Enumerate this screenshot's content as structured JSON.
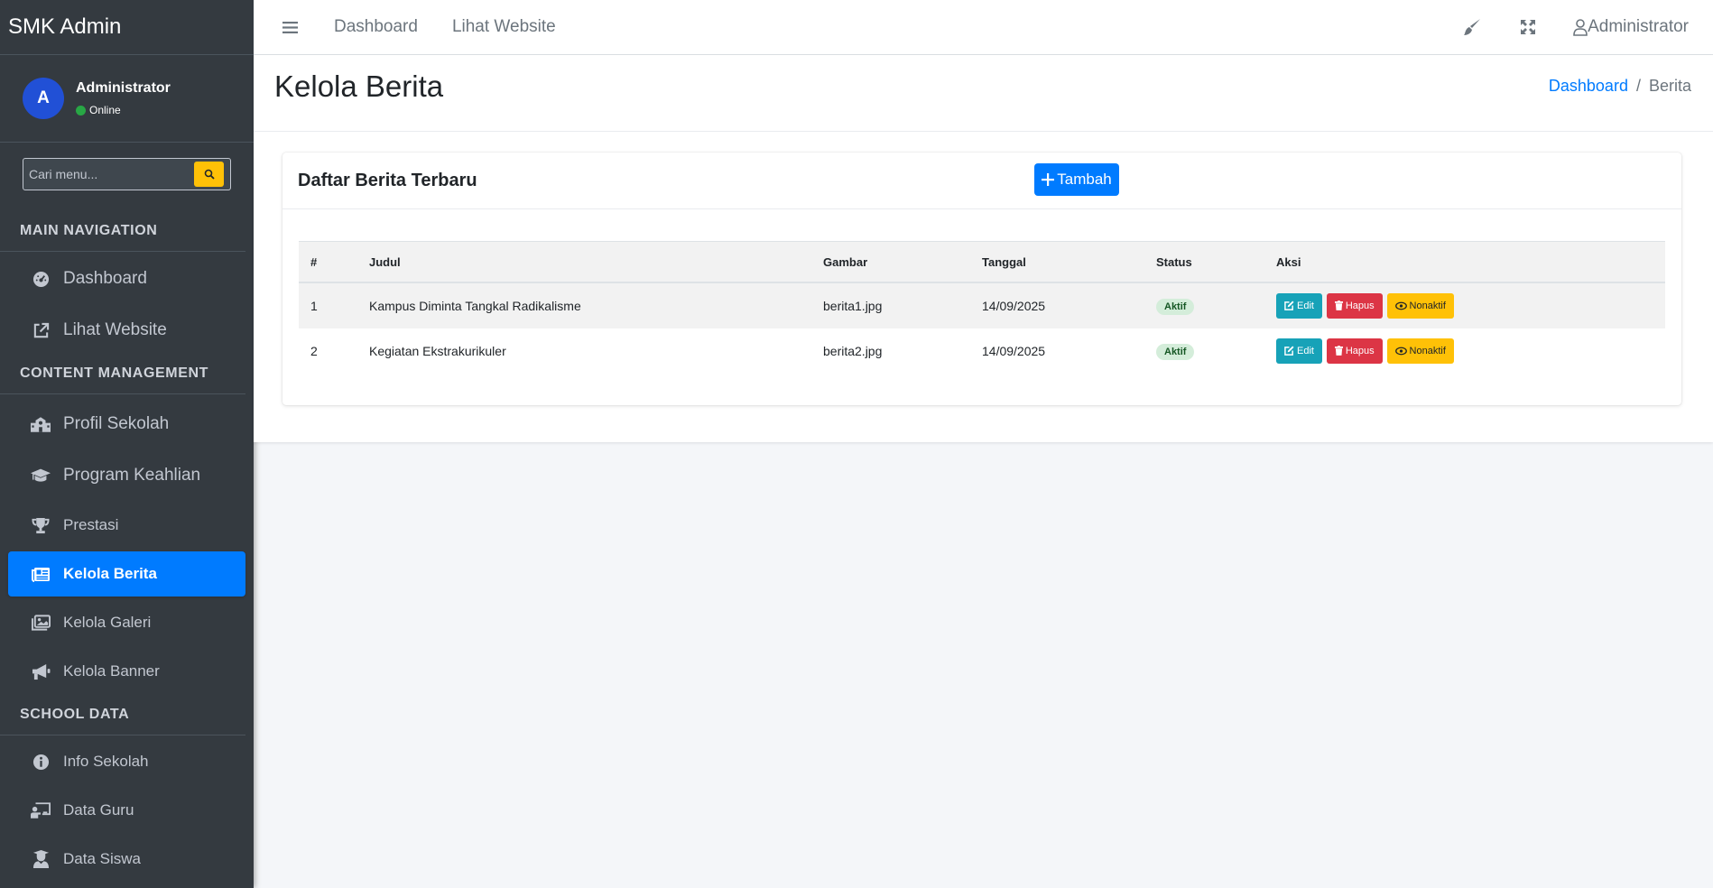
{
  "sidebar": {
    "brand": "SMK Admin",
    "user": {
      "initial": "A",
      "name": "Administrator",
      "status": "Online"
    },
    "search": {
      "placeholder": "Cari menu..."
    },
    "sections": [
      {
        "header": "MAIN NAVIGATION",
        "items": [
          {
            "label": "Dashboard",
            "icon": "gauge-icon"
          },
          {
            "label": "Lihat Website",
            "icon": "external-link-icon"
          }
        ]
      },
      {
        "header": "CONTENT MANAGEMENT",
        "items": [
          {
            "label": "Profil Sekolah",
            "icon": "school-icon"
          },
          {
            "label": "Program Keahlian",
            "icon": "graduation-cap-icon"
          },
          {
            "label": "Prestasi",
            "icon": "trophy-icon"
          },
          {
            "label": "Kelola Berita",
            "icon": "newspaper-icon",
            "active": true
          },
          {
            "label": "Kelola Galeri",
            "icon": "images-icon"
          },
          {
            "label": "Kelola Banner",
            "icon": "megaphone-icon"
          }
        ]
      },
      {
        "header": "SCHOOL DATA",
        "items": [
          {
            "label": "Info Sekolah",
            "icon": "info-circle-icon"
          },
          {
            "label": "Data Guru",
            "icon": "chalkboard-teacher-icon"
          },
          {
            "label": "Data Siswa",
            "icon": "user-graduate-icon"
          }
        ]
      }
    ]
  },
  "topbar": {
    "links": [
      "Dashboard",
      "Lihat Website"
    ],
    "user_label": "Administrator"
  },
  "page": {
    "title": "Kelola Berita",
    "breadcrumb": {
      "home": "Dashboard",
      "separator": "/",
      "current": "Berita"
    }
  },
  "card": {
    "title": "Daftar Berita Terbaru",
    "add_label": "Tambah",
    "columns": [
      "#",
      "Judul",
      "Gambar",
      "Tanggal",
      "Status",
      "Aksi"
    ],
    "rows": [
      {
        "no": "1",
        "judul": "Kampus Diminta Tangkal Radikalisme",
        "gambar": "berita1.jpg",
        "tanggal": "14/09/2025",
        "status": "Aktif"
      },
      {
        "no": "2",
        "judul": "Kegiatan Ekstrakurikuler",
        "gambar": "berita2.jpg",
        "tanggal": "14/09/2025",
        "status": "Aktif"
      }
    ],
    "actions": {
      "edit": "Edit",
      "delete": "Hapus",
      "deactivate": "Nonaktif"
    }
  },
  "colors": {
    "primary": "#007bff",
    "sidebar": "#343a40",
    "info": "#17a2b8",
    "danger": "#dc3545",
    "warning": "#ffc107",
    "success": "#28a745"
  }
}
